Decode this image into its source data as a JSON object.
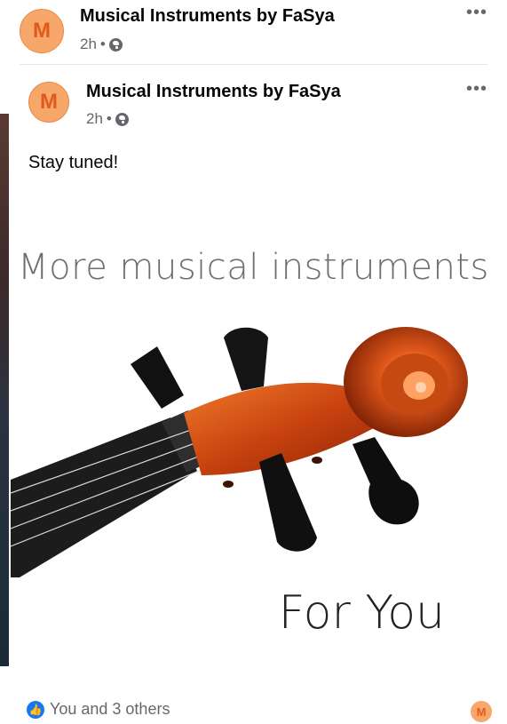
{
  "shared_post": {
    "avatar_letter": "M",
    "page_name": "Musical Instruments by FaSya",
    "time": "2h",
    "separator": "•",
    "more_label": "•••"
  },
  "original_post": {
    "avatar_letter": "M",
    "page_name": "Musical Instruments by FaSya",
    "time": "2h",
    "separator": "•",
    "more_label": "•••",
    "text": "Stay tuned!",
    "image": {
      "headline": "More musical instruments",
      "footer": "For You"
    }
  },
  "reactions": {
    "icon": "like-icon",
    "text": "You and 3 others",
    "avatar_letter": "M"
  },
  "colors": {
    "avatar_bg": "#f7a76a",
    "avatar_text": "#e05a1e",
    "like_blue": "#1877f2",
    "meta_gray": "#65676b"
  }
}
